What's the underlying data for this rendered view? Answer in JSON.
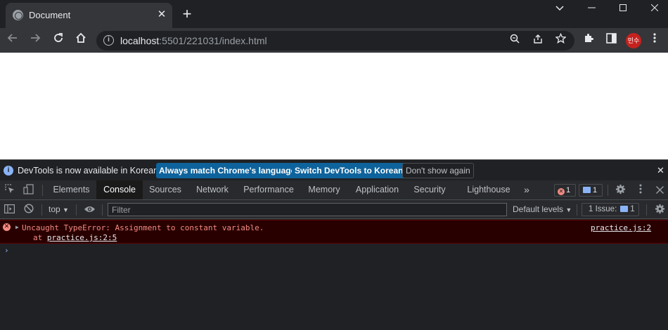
{
  "browser": {
    "tab_title": "Document",
    "tab_close": "✕",
    "new_tab": "+",
    "url_host": "localhost",
    "url_rest": ":5501/221031/index.html",
    "profile_initials": "민수"
  },
  "infobar": {
    "message": "DevTools is now available in Korean!",
    "btn_match": "Always match Chrome's language",
    "btn_switch": "Switch DevTools to Korean",
    "btn_dismiss": "Don't show again"
  },
  "devtools": {
    "tabs": [
      {
        "label": "Elements"
      },
      {
        "label": "Console"
      },
      {
        "label": "Sources"
      },
      {
        "label": "Network"
      },
      {
        "label": "Performance"
      },
      {
        "label": "Memory"
      },
      {
        "label": "Application"
      },
      {
        "label": "Security"
      },
      {
        "label": "Lighthouse"
      }
    ],
    "active_tab": "Console",
    "more_tabs": "»",
    "error_count": "1",
    "message_count": "1"
  },
  "console_toolbar": {
    "context": "top",
    "filter_placeholder": "Filter",
    "levels": "Default levels",
    "issues_label": "1 Issue:",
    "issues_count": "1"
  },
  "messages": [
    {
      "type": "error",
      "text": "Uncaught TypeError: Assignment to constant variable.",
      "at_prefix": "at ",
      "at_link": "practice.js:2:5",
      "source": "practice.js:2"
    }
  ],
  "prompt": "›",
  "colors": {
    "accent_blue": "#0e639c",
    "error_text": "#f28b82",
    "error_bg": "#290000"
  }
}
